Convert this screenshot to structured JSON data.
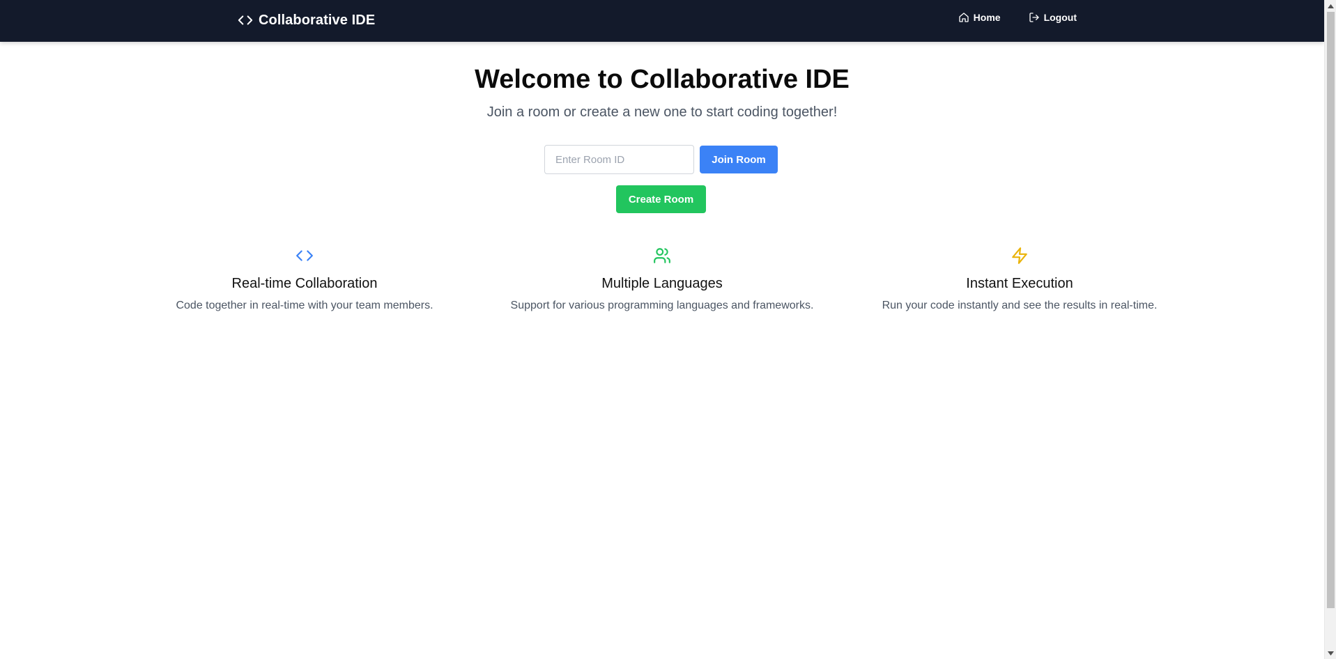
{
  "navbar": {
    "brand_title": "Collaborative IDE",
    "brand_icon": "code-icon",
    "links": [
      {
        "label": "Home",
        "icon": "home-icon"
      },
      {
        "label": "Logout",
        "icon": "logout-icon"
      }
    ],
    "background_color": "#131a2b"
  },
  "hero": {
    "title": "Welcome to Collaborative IDE",
    "subtitle": "Join a room or create a new one to start coding together!"
  },
  "join": {
    "room_input_placeholder": "Enter Room ID",
    "room_input_value": "",
    "join_button_label": "Join Room",
    "join_button_color": "#3b82f6",
    "create_button_label": "Create Room",
    "create_button_color": "#22c55e"
  },
  "features": [
    {
      "icon": "code-icon",
      "icon_color": "#3b82f6",
      "title": "Real-time Collaboration",
      "description": "Code together in real-time with your team members."
    },
    {
      "icon": "users-icon",
      "icon_color": "#22c55e",
      "title": "Multiple Languages",
      "description": "Support for various programming languages and frameworks."
    },
    {
      "icon": "zap-icon",
      "icon_color": "#eab308",
      "title": "Instant Execution",
      "description": "Run your code instantly and see the results in real-time."
    }
  ]
}
